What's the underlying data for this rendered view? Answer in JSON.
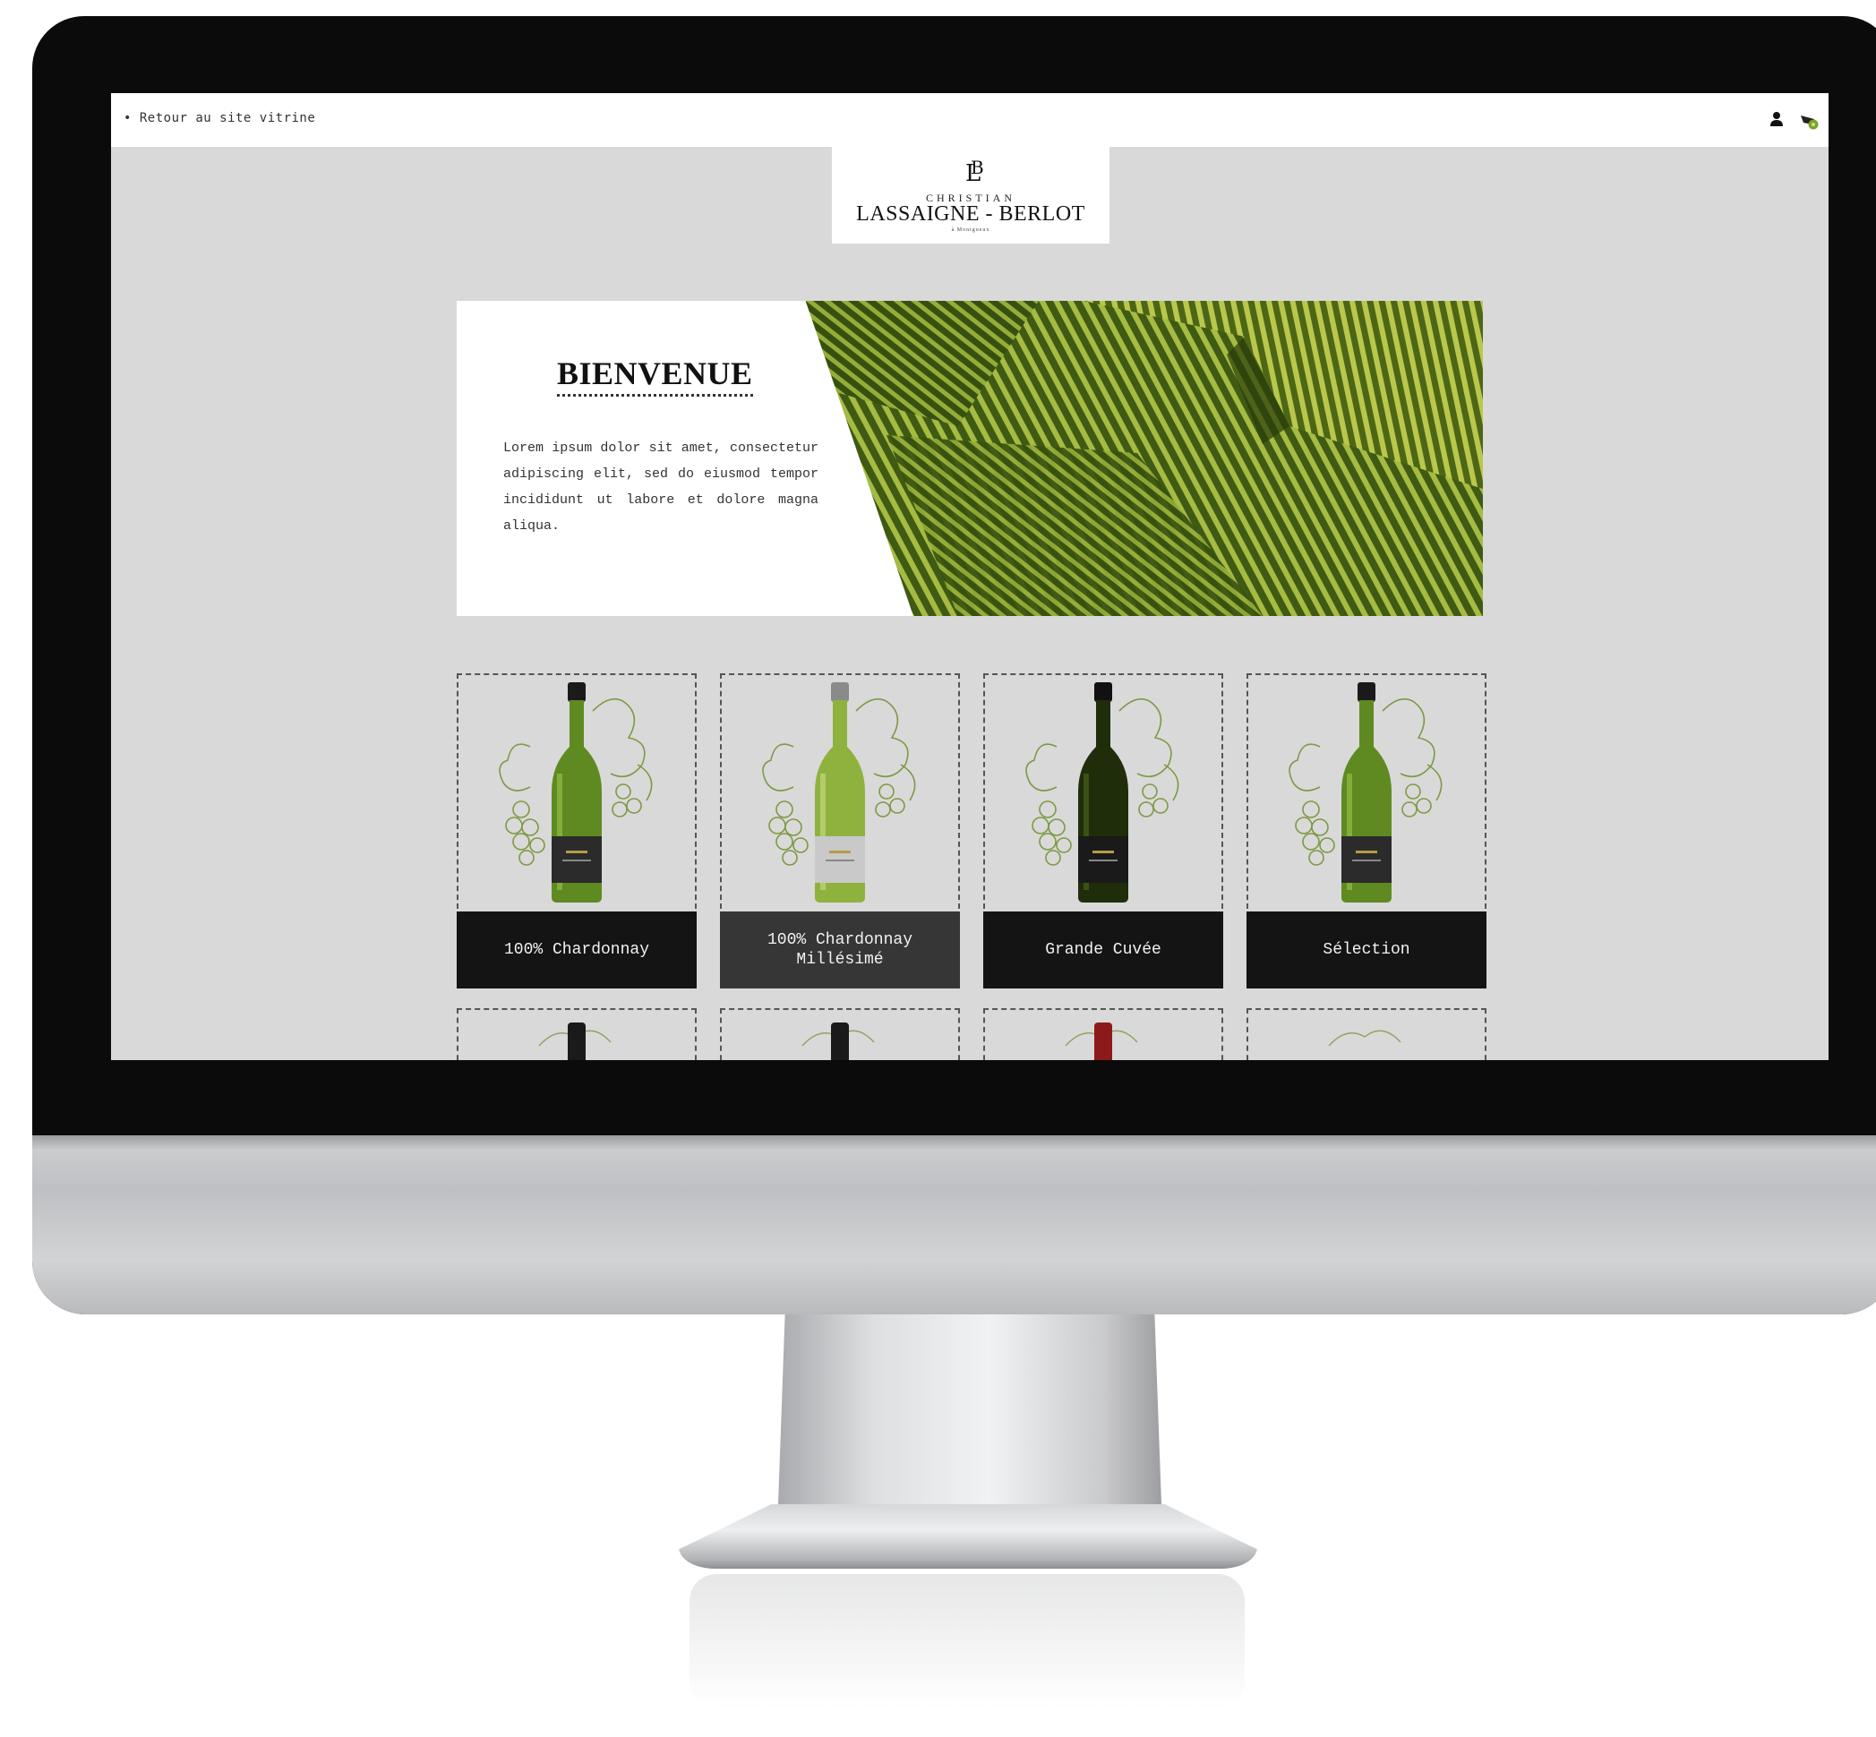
{
  "topbar": {
    "back_link": "• Retour au site vitrine",
    "user_icon": "user-icon",
    "cart_icon": "cart-icon"
  },
  "logo": {
    "monogram": "LB",
    "first_name": "CHRISTIAN",
    "name": "LASSAIGNE - BERLOT",
    "tagline": "à Montgueux"
  },
  "hero": {
    "title": "BIENVENUE",
    "text": "Lorem ipsum dolor sit amet, consectetur adipiscing elit, sed do eiusmod tempor incididunt ut labore et dolore magna aliqua."
  },
  "products": [
    {
      "label": "100% Chardonnay",
      "bottle": "green"
    },
    {
      "label": "100% Chardonnay\nMillésimé",
      "bottle": "silver"
    },
    {
      "label": "Grande Cuvée",
      "bottle": "dark"
    },
    {
      "label": "Sélection",
      "bottle": "green"
    }
  ],
  "colors": {
    "screen_bg": "#d9d9d9",
    "label_bg": "#141414",
    "label_alt_bg": "#363636",
    "vine_green": "#6e8f2a"
  }
}
